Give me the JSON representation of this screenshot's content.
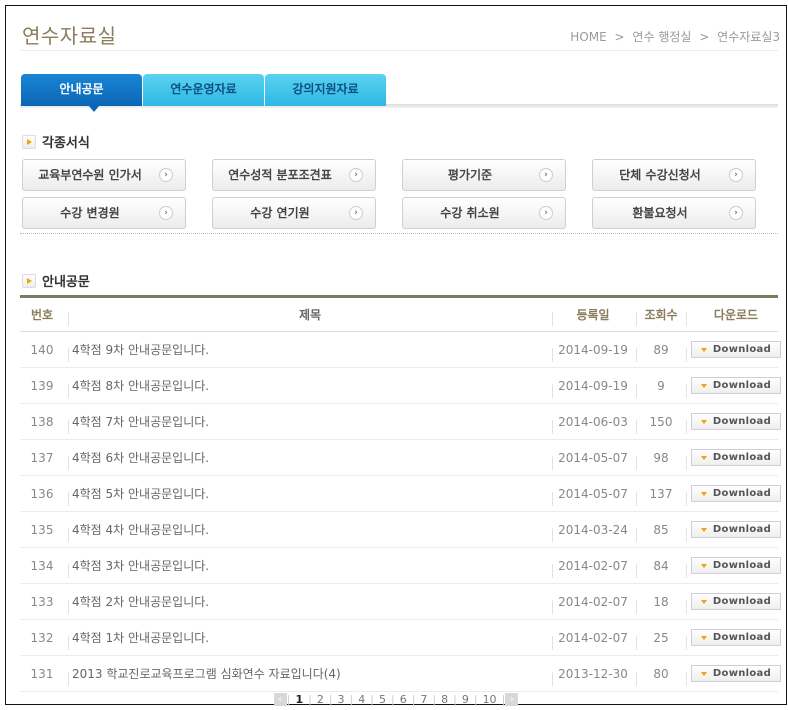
{
  "header": {
    "title": "연수자료실",
    "breadcrumb": [
      "HOME",
      "연수 행정실",
      "연수자료실3"
    ],
    "breadcrumb_sep": ">"
  },
  "tabs": [
    {
      "label": "안내공문",
      "active": true
    },
    {
      "label": "연수운영자료",
      "active": false
    },
    {
      "label": "강의지원자료",
      "active": false
    }
  ],
  "forms_section": {
    "title": "각종서식",
    "buttons": [
      {
        "label": "교육부연수원 인가서"
      },
      {
        "label": "연수성적 분포조견표"
      },
      {
        "label": "평가기준"
      },
      {
        "label": "단체 수강신청서"
      },
      {
        "label": "수강 변경원"
      },
      {
        "label": "수강 연기원"
      },
      {
        "label": "수강 취소원"
      },
      {
        "label": "환불요청서"
      }
    ],
    "arrow_icon": "›"
  },
  "notice_section": {
    "title": "안내공문",
    "columns": {
      "no": "번호",
      "title": "제목",
      "date": "등록일",
      "views": "조회수",
      "download": "다운로드"
    },
    "rows": [
      {
        "no": "140",
        "title": "4학점 9차 안내공문입니다.",
        "date": "2014-09-19",
        "views": "89",
        "download": "Download"
      },
      {
        "no": "139",
        "title": "4학점 8차 안내공문입니다.",
        "date": "2014-09-19",
        "views": "9",
        "download": "Download"
      },
      {
        "no": "138",
        "title": "4학점 7차 안내공문입니다.",
        "date": "2014-06-03",
        "views": "150",
        "download": "Download"
      },
      {
        "no": "137",
        "title": "4학점 6차 안내공문입니다.",
        "date": "2014-05-07",
        "views": "98",
        "download": "Download"
      },
      {
        "no": "136",
        "title": "4학점 5차 안내공문입니다.",
        "date": "2014-05-07",
        "views": "137",
        "download": "Download"
      },
      {
        "no": "135",
        "title": "4학점 4차 안내공문입니다.",
        "date": "2014-03-24",
        "views": "85",
        "download": "Download"
      },
      {
        "no": "134",
        "title": "4학점 3차 안내공문입니다.",
        "date": "2014-02-07",
        "views": "84",
        "download": "Download"
      },
      {
        "no": "133",
        "title": "4학점 2차 안내공문입니다.",
        "date": "2014-02-07",
        "views": "18",
        "download": "Download"
      },
      {
        "no": "132",
        "title": "4학점 1차 안내공문입니다.",
        "date": "2014-02-07",
        "views": "25",
        "download": "Download"
      },
      {
        "no": "131",
        "title": "2013 학교진로교육프로그램 심화연수 자료입니다(4)",
        "date": "2013-12-30",
        "views": "80",
        "download": "Download"
      }
    ]
  },
  "pagination": {
    "prev_icon": "‹",
    "next_icon": "›",
    "pages": [
      "1",
      "2",
      "3",
      "4",
      "5",
      "6",
      "7",
      "8",
      "9",
      "10"
    ],
    "current": "1"
  }
}
